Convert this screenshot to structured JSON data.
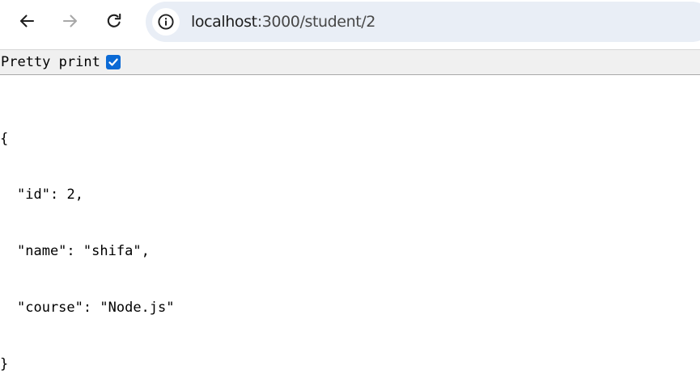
{
  "browser": {
    "url_host": "localhost",
    "url_path": ":3000/student/2",
    "icons": {
      "back": "arrow-left-icon",
      "forward": "arrow-right-icon",
      "reload": "reload-icon",
      "site_info": "info-circle-icon"
    },
    "forward_enabled": false
  },
  "viewer": {
    "pretty_print_label": "Pretty print",
    "pretty_print_checked": true,
    "accent_color": "#0b6ad5"
  },
  "json": {
    "open": "{",
    "close": "}",
    "lines": [
      {
        "key": "\"id\"",
        "sep": ": ",
        "value": "2",
        "trail": ","
      },
      {
        "key": "\"name\"",
        "sep": ": ",
        "value": "\"shifa\"",
        "trail": ","
      },
      {
        "key": "\"course\"",
        "sep": ": ",
        "value": "\"Node.js\"",
        "trail": ""
      }
    ]
  }
}
